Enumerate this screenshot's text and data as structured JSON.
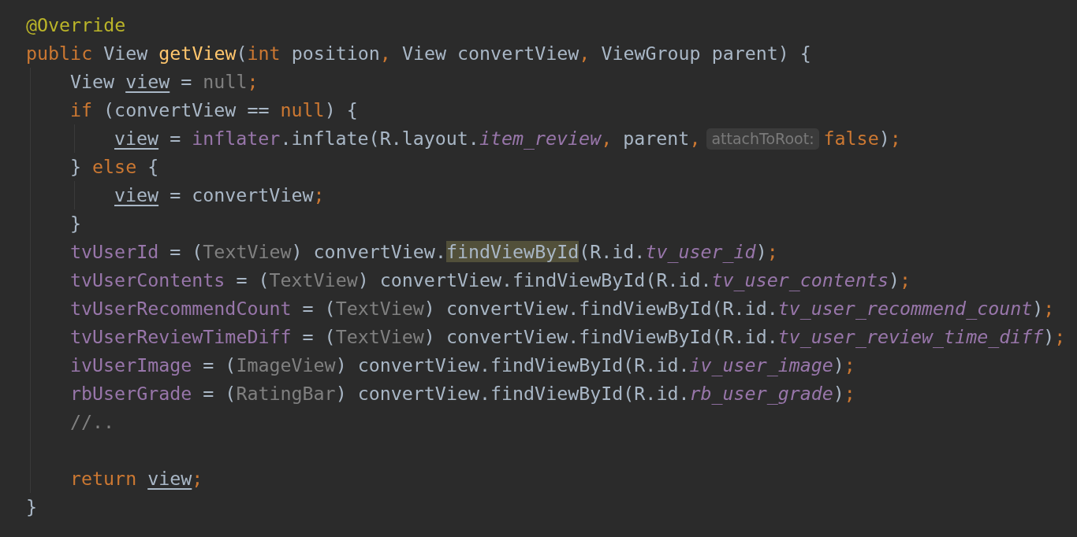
{
  "editor": {
    "lines": [
      {
        "kind": "code",
        "tokens": [
          {
            "text": "@Override",
            "kind": "annotation"
          }
        ]
      },
      {
        "kind": "code",
        "tokens": [
          {
            "text": "public",
            "kind": "keyword"
          },
          {
            "text": " View ",
            "kind": "plain"
          },
          {
            "text": "getView",
            "kind": "method"
          },
          {
            "text": "(",
            "kind": "plain"
          },
          {
            "text": "int",
            "kind": "keyword"
          },
          {
            "text": " position",
            "kind": "plain"
          },
          {
            "text": ",",
            "kind": "keyword"
          },
          {
            "text": " View convertView",
            "kind": "plain"
          },
          {
            "text": ",",
            "kind": "keyword"
          },
          {
            "text": " ViewGroup parent) {",
            "kind": "plain"
          }
        ],
        "children": [
          {
            "kind": "code",
            "tokens": [
              {
                "text": "View ",
                "kind": "plain"
              },
              {
                "text": "view",
                "kind": "variable"
              },
              {
                "text": " = ",
                "kind": "plain"
              },
              {
                "text": "null",
                "kind": "muted"
              },
              {
                "text": ";",
                "kind": "keyword"
              }
            ]
          },
          {
            "kind": "code",
            "tokens": [
              {
                "text": "if",
                "kind": "keyword"
              },
              {
                "text": " (convertView == ",
                "kind": "plain"
              },
              {
                "text": "null",
                "kind": "keyword"
              },
              {
                "text": ") {",
                "kind": "plain"
              }
            ],
            "children": [
              {
                "kind": "code",
                "tokens": [
                  {
                    "text": "view",
                    "kind": "variable"
                  },
                  {
                    "text": " = ",
                    "kind": "plain"
                  },
                  {
                    "text": "inflater",
                    "kind": "field"
                  },
                  {
                    "text": ".inflate(R.layout.",
                    "kind": "plain"
                  },
                  {
                    "text": "item_review",
                    "kind": "constant"
                  },
                  {
                    "text": ",",
                    "kind": "keyword"
                  },
                  {
                    "text": " parent",
                    "kind": "plain"
                  },
                  {
                    "text": ",",
                    "kind": "keyword"
                  },
                  {
                    "text": "attachToRoot:",
                    "kind": "hint"
                  },
                  {
                    "text": "false",
                    "kind": "keyword"
                  },
                  {
                    "text": ")",
                    "kind": "plain"
                  },
                  {
                    "text": ";",
                    "kind": "keyword"
                  }
                ]
              }
            ]
          },
          {
            "kind": "code",
            "tokens": [
              {
                "text": "} ",
                "kind": "plain"
              },
              {
                "text": "else",
                "kind": "keyword"
              },
              {
                "text": " {",
                "kind": "plain"
              }
            ],
            "children": [
              {
                "kind": "code",
                "tokens": [
                  {
                    "text": "view",
                    "kind": "variable"
                  },
                  {
                    "text": " = convertView",
                    "kind": "plain"
                  },
                  {
                    "text": ";",
                    "kind": "keyword"
                  }
                ]
              }
            ]
          },
          {
            "kind": "code",
            "tokens": [
              {
                "text": "}",
                "kind": "plain"
              }
            ]
          },
          {
            "kind": "code",
            "tokens": [
              {
                "text": "tvUserId",
                "kind": "field"
              },
              {
                "text": " = (",
                "kind": "plain"
              },
              {
                "text": "TextView",
                "kind": "muted"
              },
              {
                "text": ") convertView.",
                "kind": "plain"
              },
              {
                "text": "findViewById",
                "kind": "match"
              },
              {
                "text": "(R.id.",
                "kind": "plain"
              },
              {
                "text": "tv_user_id",
                "kind": "constant"
              },
              {
                "text": ")",
                "kind": "plain"
              },
              {
                "text": ";",
                "kind": "keyword"
              }
            ]
          },
          {
            "kind": "code",
            "tokens": [
              {
                "text": "tvUserContents",
                "kind": "field"
              },
              {
                "text": " = (",
                "kind": "plain"
              },
              {
                "text": "TextView",
                "kind": "muted"
              },
              {
                "text": ") convertView.findViewById(R.id.",
                "kind": "plain"
              },
              {
                "text": "tv_user_contents",
                "kind": "constant"
              },
              {
                "text": ")",
                "kind": "plain"
              },
              {
                "text": ";",
                "kind": "keyword"
              }
            ]
          },
          {
            "kind": "code",
            "tokens": [
              {
                "text": "tvUserRecommendCount",
                "kind": "field"
              },
              {
                "text": " = (",
                "kind": "plain"
              },
              {
                "text": "TextView",
                "kind": "muted"
              },
              {
                "text": ") convertView.findViewById(R.id.",
                "kind": "plain"
              },
              {
                "text": "tv_user_recommend_count",
                "kind": "constant"
              },
              {
                "text": ")",
                "kind": "plain"
              },
              {
                "text": ";",
                "kind": "keyword"
              }
            ]
          },
          {
            "kind": "code",
            "tokens": [
              {
                "text": "tvUserReviewTimeDiff",
                "kind": "field"
              },
              {
                "text": " = (",
                "kind": "plain"
              },
              {
                "text": "TextView",
                "kind": "muted"
              },
              {
                "text": ") convertView.findViewById(R.id.",
                "kind": "plain"
              },
              {
                "text": "tv_user_review_time_diff",
                "kind": "constant"
              },
              {
                "text": ")",
                "kind": "plain"
              },
              {
                "text": ";",
                "kind": "keyword"
              }
            ]
          },
          {
            "kind": "code",
            "tokens": [
              {
                "text": "ivUserImage",
                "kind": "field"
              },
              {
                "text": " = (",
                "kind": "plain"
              },
              {
                "text": "ImageView",
                "kind": "muted"
              },
              {
                "text": ") convertView.findViewById(R.id.",
                "kind": "plain"
              },
              {
                "text": "iv_user_image",
                "kind": "constant"
              },
              {
                "text": ")",
                "kind": "plain"
              },
              {
                "text": ";",
                "kind": "keyword"
              }
            ]
          },
          {
            "kind": "code",
            "tokens": [
              {
                "text": "rbUserGrade",
                "kind": "field"
              },
              {
                "text": " = (",
                "kind": "plain"
              },
              {
                "text": "RatingBar",
                "kind": "muted"
              },
              {
                "text": ") convertView.findViewById(R.id.",
                "kind": "plain"
              },
              {
                "text": "rb_user_grade",
                "kind": "constant"
              },
              {
                "text": ")",
                "kind": "plain"
              },
              {
                "text": ";",
                "kind": "keyword"
              }
            ]
          },
          {
            "kind": "code",
            "tokens": [
              {
                "text": "//..",
                "kind": "comment"
              }
            ]
          },
          {
            "kind": "blank"
          },
          {
            "kind": "code",
            "tokens": [
              {
                "text": "return ",
                "kind": "keyword"
              },
              {
                "text": "view",
                "kind": "variable"
              },
              {
                "text": ";",
                "kind": "keyword"
              }
            ]
          }
        ]
      },
      {
        "kind": "code",
        "tokens": [
          {
            "text": "}",
            "kind": "plain"
          }
        ]
      }
    ]
  }
}
